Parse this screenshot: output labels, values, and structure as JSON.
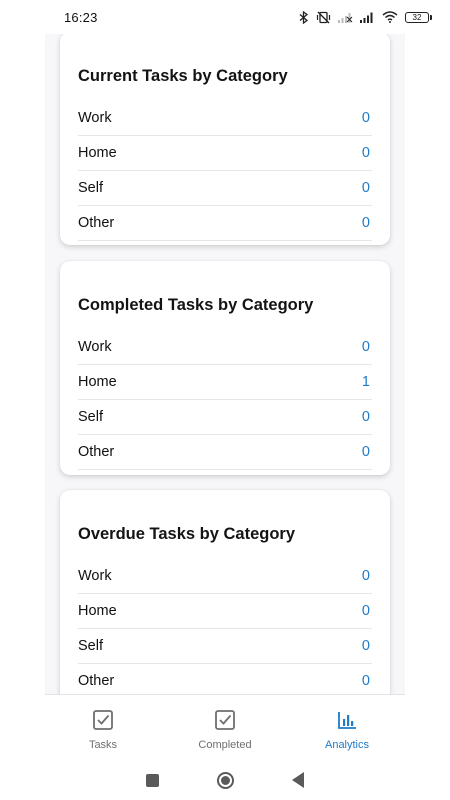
{
  "status_bar": {
    "time": "16:23",
    "battery": "32",
    "icons": [
      "bluetooth-icon",
      "vibrate-off-icon",
      "signal-icon",
      "signal-icon",
      "wifi-icon",
      "battery-icon"
    ]
  },
  "cards": [
    {
      "title": "Current Tasks by Category",
      "rows": [
        {
          "label": "Work",
          "value": "0"
        },
        {
          "label": "Home",
          "value": "0"
        },
        {
          "label": "Self",
          "value": "0"
        },
        {
          "label": "Other",
          "value": "0"
        }
      ]
    },
    {
      "title": "Completed Tasks by Category",
      "rows": [
        {
          "label": "Work",
          "value": "0"
        },
        {
          "label": "Home",
          "value": "1"
        },
        {
          "label": "Self",
          "value": "0"
        },
        {
          "label": "Other",
          "value": "0"
        }
      ]
    },
    {
      "title": "Overdue Tasks by Category",
      "rows": [
        {
          "label": "Work",
          "value": "0"
        },
        {
          "label": "Home",
          "value": "0"
        },
        {
          "label": "Self",
          "value": "0"
        },
        {
          "label": "Other",
          "value": "0"
        }
      ]
    }
  ],
  "bottom_nav": {
    "items": [
      {
        "label": "Tasks",
        "icon": "checkbox-icon",
        "active": false
      },
      {
        "label": "Completed",
        "icon": "checkbox-icon",
        "active": false
      },
      {
        "label": "Analytics",
        "icon": "bar-chart-icon",
        "active": true
      }
    ]
  },
  "colors": {
    "accent": "#1f7ac8",
    "inactive": "#6f6f6f",
    "background": "#f7f7f9"
  }
}
